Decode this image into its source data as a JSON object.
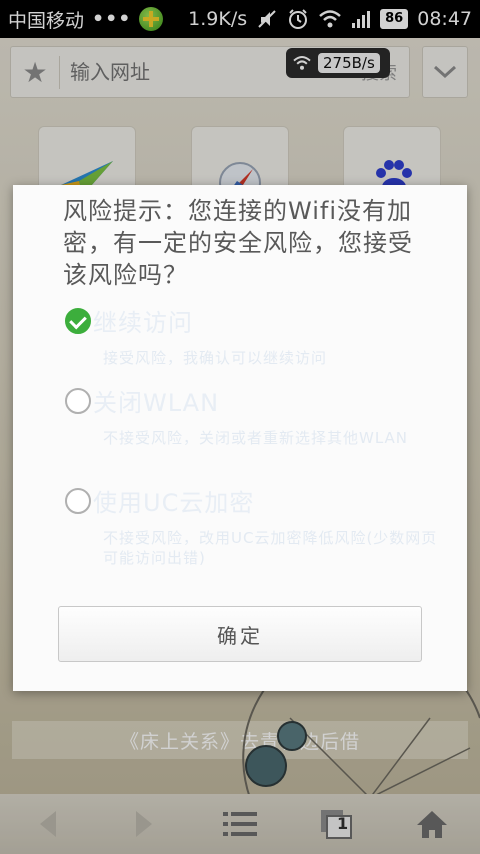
{
  "status_bar": {
    "carrier": "中国移动",
    "dots": "•••",
    "net_speed": "1.9K/s",
    "battery": "86",
    "time": "08:47"
  },
  "browser": {
    "address_placeholder": "输入网址",
    "search_label": "搜索",
    "speed_badge": "275B/s",
    "novel_banner": "《床上关系》去青松边后借",
    "tabs_count": "1"
  },
  "dialog": {
    "title": "风险提示：您连接的Wifi没有加密，有一定的安全风险，您接受该风险吗？",
    "options": [
      {
        "label": "继续访问",
        "desc": "接受风险，我确认可以继续访问",
        "checked": true
      },
      {
        "label": "关闭WLAN",
        "desc": "不接受风险，关闭或者重新选择其他WLAN",
        "checked": false
      },
      {
        "label": "使用UC云加密",
        "desc": "不接受风险，改用UC云加密降低风险(少数网页可能访问出错)",
        "checked": false
      }
    ],
    "confirm_label": "确定"
  },
  "colors": {
    "check_green": "#3cae3c",
    "dialog_bg": "#fbfbfb",
    "status_bar_bg": "#000000"
  },
  "icons": [
    "signal-dots-icon",
    "app-notification-icon",
    "mute-icon",
    "alarm-icon",
    "wifi-icon",
    "cell-signal-icon",
    "battery-icon",
    "star-icon",
    "chevron-down-icon",
    "back-icon",
    "forward-icon",
    "menu-list-icon",
    "tabs-icon",
    "home-icon"
  ]
}
